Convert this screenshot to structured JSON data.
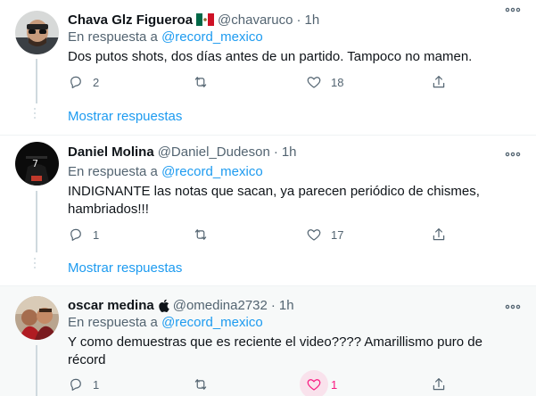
{
  "tweets": [
    {
      "name": "Chava Glz Figueroa",
      "handle": "@chavaruco",
      "sep": "·",
      "time": "1h",
      "reply_prefix": "En respuesta a",
      "reply_mention": "@record_mexico",
      "text_lines": [
        "Dos putos shots, dos días antes de un partido. Tampoco no mamen."
      ],
      "replies": "2",
      "retweets": "",
      "likes": "18",
      "liked": false,
      "show_replies": "Mostrar respuestas",
      "flag": "mexico-flag-emoji"
    },
    {
      "name": "Daniel Molina",
      "handle": "@Daniel_Dudeson",
      "sep": "·",
      "time": "1h",
      "reply_prefix": "En respuesta a",
      "reply_mention": "@record_mexico",
      "text_lines": [
        "INDIGNANTE las notas que sacan, ya parecen periódico de chismes,",
        "hambriados!!!"
      ],
      "replies": "1",
      "retweets": "",
      "likes": "17",
      "liked": false,
      "show_replies": "Mostrar respuestas"
    },
    {
      "name": "oscar medina",
      "handle": "@omedina2732",
      "sep": "·",
      "time": "1h",
      "reply_prefix": "En respuesta a",
      "reply_mention": "@record_mexico",
      "text_lines": [
        "Y como demuestras que es reciente el video???? Amarillismo puro de",
        "récord"
      ],
      "replies": "1",
      "retweets": "",
      "likes": "1",
      "liked": true,
      "badge": "apple-icon"
    }
  ],
  "colors": {
    "accent": "#1d9bf0",
    "secondary_text": "#536471",
    "like": "#f91880",
    "divider": "#eff3f4"
  }
}
